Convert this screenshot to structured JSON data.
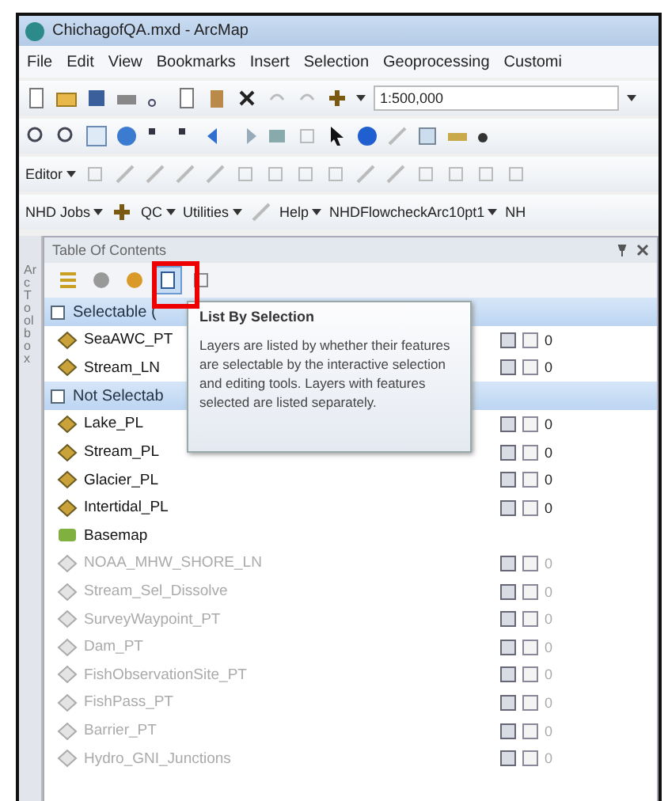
{
  "window": {
    "title": "ChichagofQA.mxd - ArcMap"
  },
  "menu": [
    "File",
    "Edit",
    "View",
    "Bookmarks",
    "Insert",
    "Selection",
    "Geoprocessing",
    "Customi"
  ],
  "standard_toolbar": {
    "scale": "1:500,000"
  },
  "editor_toolbar": {
    "label": "Editor"
  },
  "custom_toolbar": [
    "NHD Jobs",
    "QC",
    "Utilities",
    "Help",
    "NHDFlowcheckArc10pt1",
    "NH"
  ],
  "side_tab": "ArcToolbox",
  "toc": {
    "title": "Table Of Contents",
    "view_buttons": [
      {
        "selected": false
      },
      {
        "selected": false
      },
      {
        "selected": false
      },
      {
        "selected": true
      },
      {
        "selected": false
      }
    ],
    "rows": [
      {
        "kind": "group",
        "label": "Selectable ("
      },
      {
        "kind": "layer",
        "label": "SeaAWC_PT",
        "count": "0",
        "dimmed": false
      },
      {
        "kind": "layer",
        "label": "Stream_LN",
        "count": "0",
        "dimmed": false
      },
      {
        "kind": "group",
        "label": "Not Selectab"
      },
      {
        "kind": "layer",
        "label": "Lake_PL",
        "count": "0",
        "dimmed": false
      },
      {
        "kind": "layer",
        "label": "Stream_PL",
        "count": "0",
        "dimmed": false
      },
      {
        "kind": "layer",
        "label": "Glacier_PL",
        "count": "0",
        "dimmed": false
      },
      {
        "kind": "layer",
        "label": "Intertidal_PL",
        "count": "0",
        "dimmed": false
      },
      {
        "kind": "basemap",
        "label": "Basemap"
      },
      {
        "kind": "layer",
        "label": "NOAA_MHW_SHORE_LN",
        "count": "0",
        "dimmed": true
      },
      {
        "kind": "layer",
        "label": "Stream_Sel_Dissolve",
        "count": "0",
        "dimmed": true
      },
      {
        "kind": "layer",
        "label": "SurveyWaypoint_PT",
        "count": "0",
        "dimmed": true
      },
      {
        "kind": "layer",
        "label": "Dam_PT",
        "count": "0",
        "dimmed": true
      },
      {
        "kind": "layer",
        "label": "FishObservationSite_PT",
        "count": "0",
        "dimmed": true
      },
      {
        "kind": "layer",
        "label": "FishPass_PT",
        "count": "0",
        "dimmed": true
      },
      {
        "kind": "layer",
        "label": "Barrier_PT",
        "count": "0",
        "dimmed": true
      },
      {
        "kind": "layer",
        "label": "Hydro_GNI_Junctions",
        "count": "0",
        "dimmed": true
      }
    ]
  },
  "tooltip": {
    "title": "List By Selection",
    "text": "Layers are listed by whether their features are selectable by the interactive selection and editing tools. Layers with features selected are listed separately."
  }
}
